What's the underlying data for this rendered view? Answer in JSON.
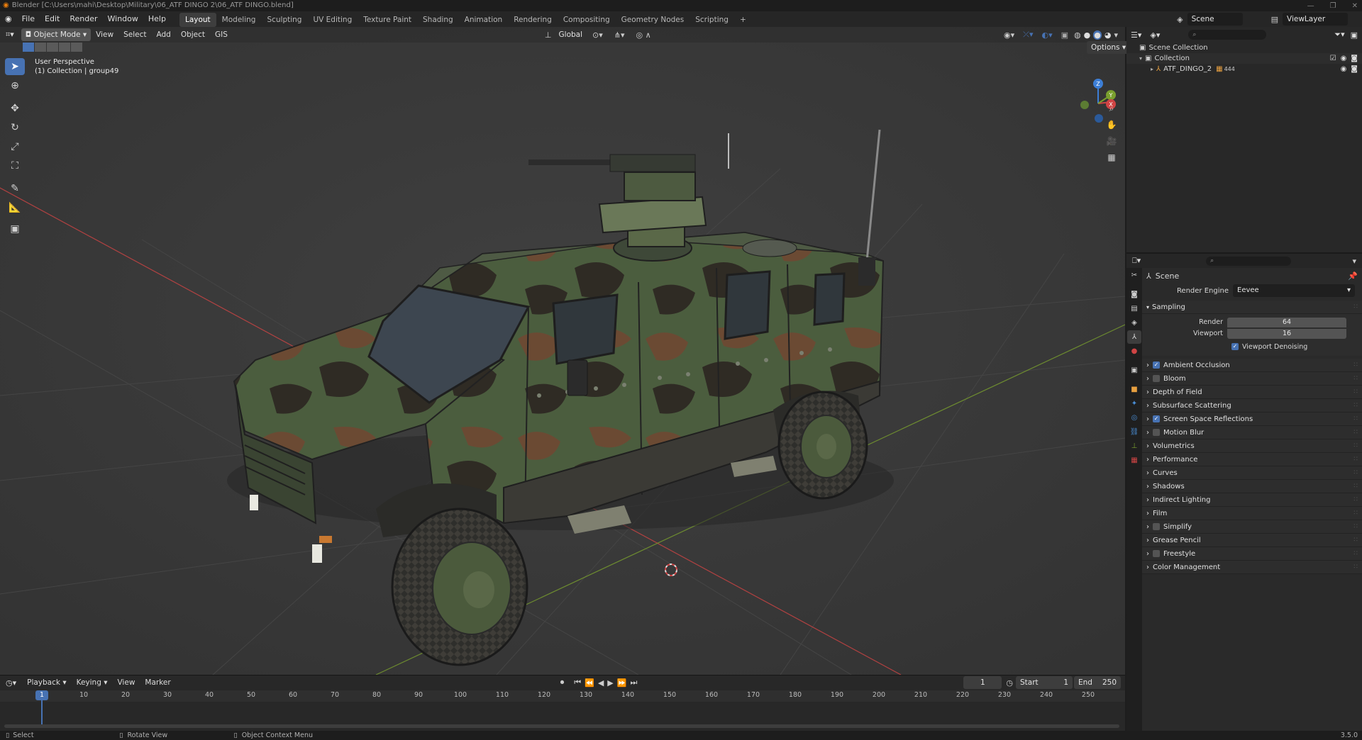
{
  "titlebar": {
    "title": "Blender [C:\\Users\\mahi\\Desktop\\Military\\06_ATF DINGO 2\\06_ATF DINGO.blend]"
  },
  "menubar": {
    "menus": [
      "File",
      "Edit",
      "Render",
      "Window",
      "Help"
    ],
    "workspaces": [
      "Layout",
      "Modeling",
      "Sculpting",
      "UV Editing",
      "Texture Paint",
      "Shading",
      "Animation",
      "Rendering",
      "Compositing",
      "Geometry Nodes",
      "Scripting"
    ],
    "active_workspace": "Layout",
    "add_workspace": "+",
    "scene_label": "Scene",
    "viewlayer_label": "ViewLayer"
  },
  "viewport": {
    "mode": "Object Mode",
    "menus": [
      "View",
      "Select",
      "Add",
      "Object",
      "GIS"
    ],
    "transform_orientation": "Global",
    "options_label": "Options",
    "overlay_text_1": "User Perspective",
    "overlay_text_2": "(1) Collection | group49",
    "gizmo_axes": [
      "Z",
      "Y",
      "X"
    ]
  },
  "timeline": {
    "menus": [
      "Playback",
      "Keying",
      "View",
      "Marker"
    ],
    "current_frame": "1",
    "start_label": "Start",
    "start_value": "1",
    "end_label": "End",
    "end_value": "250",
    "ruler": [
      "10",
      "20",
      "30",
      "40",
      "50",
      "60",
      "70",
      "80",
      "90",
      "100",
      "110",
      "120",
      "130",
      "140",
      "150",
      "160",
      "170",
      "180",
      "190",
      "200",
      "210",
      "220",
      "230",
      "240",
      "250"
    ],
    "playhead": "1"
  },
  "statusbar": {
    "items": [
      "Select",
      "Rotate View",
      "Object Context Menu"
    ],
    "version": "3.5.0"
  },
  "outliner": {
    "rows": [
      {
        "label": "Scene Collection"
      },
      {
        "label": "Collection"
      },
      {
        "label": "ATF_DINGO_2",
        "badge": "444"
      }
    ]
  },
  "properties": {
    "context": "Scene",
    "render_engine_label": "Render Engine",
    "render_engine_value": "Eevee",
    "sampling": {
      "title": "Sampling",
      "render_label": "Render",
      "render_value": "64",
      "viewport_label": "Viewport",
      "viewport_value": "16",
      "denoise_label": "Viewport Denoising"
    },
    "panels": [
      {
        "label": "Ambient Occlusion",
        "checkbox": "on"
      },
      {
        "label": "Bloom",
        "checkbox": "off"
      },
      {
        "label": "Depth of Field",
        "checkbox": "none"
      },
      {
        "label": "Subsurface Scattering",
        "checkbox": "none"
      },
      {
        "label": "Screen Space Reflections",
        "checkbox": "on"
      },
      {
        "label": "Motion Blur",
        "checkbox": "off"
      },
      {
        "label": "Volumetrics",
        "checkbox": "none"
      },
      {
        "label": "Performance",
        "checkbox": "none"
      },
      {
        "label": "Curves",
        "checkbox": "none"
      },
      {
        "label": "Shadows",
        "checkbox": "none"
      },
      {
        "label": "Indirect Lighting",
        "checkbox": "none"
      },
      {
        "label": "Film",
        "checkbox": "none"
      },
      {
        "label": "Simplify",
        "checkbox": "off"
      },
      {
        "label": "Grease Pencil",
        "checkbox": "none"
      },
      {
        "label": "Freestyle",
        "checkbox": "off"
      },
      {
        "label": "Color Management",
        "checkbox": "none"
      }
    ]
  },
  "colors": {
    "accent": "#4772b3",
    "x_axis": "#d04444",
    "y_axis": "#7aa02e",
    "camo_green": "#4b5d3e",
    "camo_brown": "#6b4a33"
  }
}
